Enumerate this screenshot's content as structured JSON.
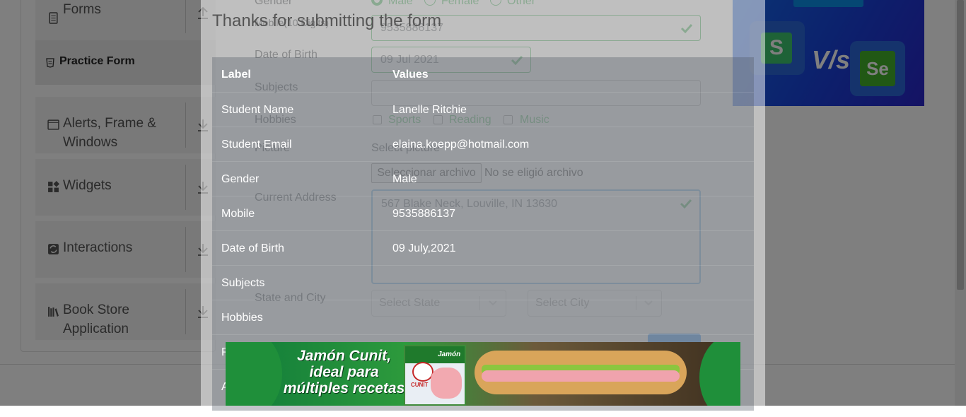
{
  "sidebar": {
    "groups": [
      {
        "label": "Forms",
        "icon": "document-icon"
      },
      {
        "label": "Alerts, Frame &",
        "label2": "Windows",
        "icon": "window-icon"
      },
      {
        "label": "Widgets",
        "icon": "widgets-icon"
      },
      {
        "label": "Interactions",
        "icon": "interactions-icon"
      },
      {
        "label": "Book Store",
        "label2": "Application",
        "icon": "books-icon"
      }
    ],
    "active_item": "Practice Form"
  },
  "form": {
    "gender_label": "Gender",
    "gender_options": [
      "Male",
      "Female",
      "Other"
    ],
    "mobile_label": "Mobile(10 Digits)",
    "mobile_value": "9535886137",
    "dob_label": "Date of Birth",
    "dob_value": "09 Jul 2021",
    "subjects_label": "Subjects",
    "hobbies_label": "Hobbies",
    "hobbies": [
      "Sports",
      "Reading",
      "Music"
    ],
    "picture_label": "Picture",
    "select_picture": "Select picture",
    "file_button": "Seleccionar archivo",
    "file_status": "No se eligió archivo",
    "address_label": "Current Address",
    "address_value": "567 Blake Neck, Louville, IN 13630",
    "state_city_label": "State and City",
    "state_placeholder": "Select State",
    "city_placeholder": "Select City"
  },
  "modal": {
    "title": "Thanks for submitting the form",
    "header_label": "Label",
    "header_value": "Values",
    "rows": [
      {
        "label": "Student Name",
        "value": "Lanelle Ritchie"
      },
      {
        "label": "Student Email",
        "value": "elaina.koepp@hotmail.com"
      },
      {
        "label": "Gender",
        "value": "Male"
      },
      {
        "label": "Mobile",
        "value": "9535886137"
      },
      {
        "label": "Date of Birth",
        "value": "09 July,2021"
      },
      {
        "label": "Subjects",
        "value": ""
      },
      {
        "label": "Hobbies",
        "value": ""
      },
      {
        "label": "P",
        "value": ""
      },
      {
        "label": "A",
        "value": ""
      }
    ]
  },
  "ads": {
    "bottom_line1": "Jamón Cunit,",
    "bottom_line2": "ideal para",
    "bottom_line3": "múltiples recetas",
    "package_brand": "CUNIT",
    "package_label": "Jamón",
    "right_vs": "V/s"
  },
  "colors": {
    "valid_green": "#28a745",
    "sidebar_bg": "#f2f2f2",
    "ad_blue": "#1a3fd8"
  }
}
